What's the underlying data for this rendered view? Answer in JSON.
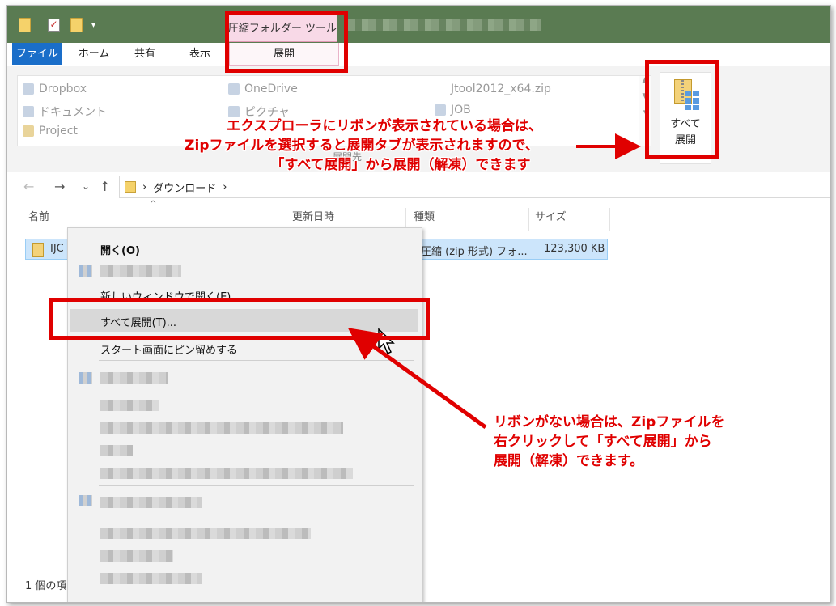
{
  "titlebar": {
    "contextual_tab_title": "圧縮フォルダー ツール",
    "qa_dropdown": "▾"
  },
  "menubar": {
    "tabs": [
      "ファイル",
      "ホーム",
      "共有",
      "表示"
    ],
    "active_contextual": "展開"
  },
  "ribbon": {
    "gallery": [
      {
        "label": "Dropbox",
        "icon": "dropbox-icon"
      },
      {
        "label": "ドキュメント",
        "icon": "documents-icon"
      },
      {
        "label": "Project",
        "icon": "folder-icon"
      },
      {
        "label": "OneDrive",
        "icon": "onedrive-icon"
      },
      {
        "label": "ピクチャ",
        "icon": "pictures-icon"
      },
      {
        "label": "Jtool2012_x64.zip",
        "icon": "zip-icon"
      },
      {
        "label": "JOB",
        "icon": "folder-icon"
      }
    ],
    "extract_all_label_1": "すべて",
    "extract_all_label_2": "展開",
    "group_label": "展開先"
  },
  "navigation": {
    "back": "←",
    "forward": "→",
    "recent": "⌄",
    "up": "↑",
    "sep1": "›",
    "folder": "ダウンロード",
    "sep2": "›"
  },
  "columns": {
    "name": "名前",
    "modified": "更新日時",
    "type": "種類",
    "size": "サイズ"
  },
  "file": {
    "name_prefix": "IJC",
    "type": "圧縮 (zip 形式) フォ...",
    "size": "123,300 KB"
  },
  "status": {
    "count": "1 個の項"
  },
  "context_menu": {
    "open": "開く(O)",
    "open_new_window": "新しいウィンドウで開く(E)",
    "extract_all": "すべて展開(T)...",
    "pin_start": "スタート画面にピン留めする"
  },
  "annotations": {
    "top_note": [
      "エクスプローラにリボンが表示されている場合は、",
      "Zipファイルを選択すると展開タブが表示されますので、",
      "「すべて展開」から展開（解凍）できます"
    ],
    "bottom_note": [
      "リボンがない場合は、Zipファイルを",
      "右クリックして「すべて展開」から",
      "展開（解凍）できます。"
    ],
    "highlight_color": "#e00000"
  }
}
